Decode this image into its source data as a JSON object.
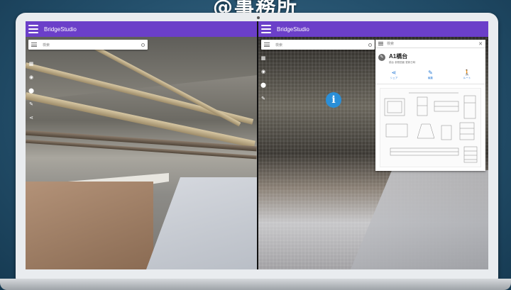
{
  "office_label": "@事務所",
  "left_viewer": {
    "app_title": "BridgeStudio",
    "search_placeholder": "検索",
    "tools": [
      "layers-icon",
      "eye-icon",
      "pin-icon",
      "pencil-icon",
      "share-icon"
    ]
  },
  "right_viewer": {
    "app_title": "BridgeStudio",
    "search_placeholder": "検索",
    "info_marker": "i",
    "panel": {
      "search_placeholder": "検索",
      "title": "A1橋台",
      "subtitle": "橋台    参照図面  更新日時",
      "actions": [
        {
          "icon": "share-icon",
          "label": "シェア"
        },
        {
          "icon": "edit-icon",
          "label": "編集"
        },
        {
          "icon": "walk-icon",
          "label": "ルート"
        }
      ]
    }
  },
  "colors": {
    "appbar": "#6b3fc9",
    "accent_blue": "#2b7cd6",
    "info_marker": "#2a8fd8"
  }
}
